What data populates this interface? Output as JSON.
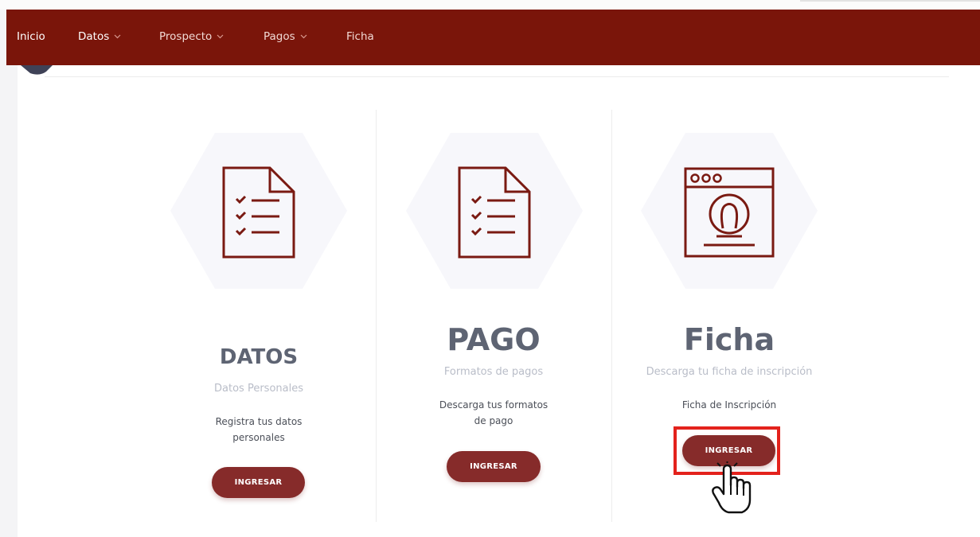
{
  "nav": {
    "items": [
      {
        "label": "Inicio",
        "has_dropdown": false
      },
      {
        "label": "Datos",
        "has_dropdown": true
      },
      {
        "label": "Prospecto",
        "has_dropdown": true
      },
      {
        "label": "Pagos",
        "has_dropdown": true
      },
      {
        "label": "Ficha",
        "has_dropdown": false
      }
    ]
  },
  "cards": [
    {
      "title": "DATOS",
      "subtitle": "Datos Personales",
      "desc_line1": "Registra tus datos",
      "desc_line2": "personales",
      "button": "INGRESAR",
      "icon": "checklist-document-icon"
    },
    {
      "title": "PAGO",
      "subtitle": "Formatos de pagos",
      "desc_line1": "Descarga tus formatos",
      "desc_line2": "de pago",
      "button": "INGRESAR",
      "icon": "checklist-document-icon"
    },
    {
      "title": "Ficha",
      "subtitle": "Descarga tu ficha de inscripción",
      "desc_line1": "Ficha de Inscripción",
      "desc_line2": "",
      "button": "INGRESAR",
      "icon": "profile-window-icon"
    }
  ],
  "colors": {
    "navbar": "#7a150a",
    "button": "#862b2a",
    "icon_stroke": "#7a1a12",
    "title": "#5e6473",
    "subtitle": "#b9bdc8",
    "highlight": "#e3221c"
  }
}
